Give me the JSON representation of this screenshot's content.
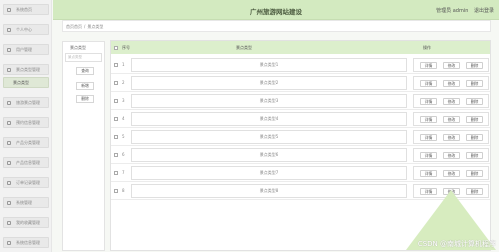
{
  "header": {
    "title": "广州旅游网站建设",
    "user": "管理员 admin",
    "logout": "退出登录"
  },
  "breadcrumb": {
    "home": "首页首页",
    "sep": "/",
    "current": "景点类型"
  },
  "sidebar": {
    "items": [
      {
        "label": "系统首页"
      },
      {
        "label": "个人中心"
      },
      {
        "label": "用户管理"
      },
      {
        "label": "景点类型管理"
      },
      {
        "label": "景点类型"
      },
      {
        "label": "旅游景点管理"
      },
      {
        "label": "预约信息管理"
      },
      {
        "label": "产品分类管理"
      },
      {
        "label": "产品信息管理"
      },
      {
        "label": "订单记录管理"
      },
      {
        "label": "系统管理"
      },
      {
        "label": "我的收藏管理"
      },
      {
        "label": "系统信息管理"
      }
    ]
  },
  "subpanel": {
    "title": "景点类型",
    "search_placeholder": "景点类型",
    "buttons": [
      "查询",
      "新增",
      "删除"
    ]
  },
  "table": {
    "headers": {
      "index": "序号",
      "name": "景点类型",
      "ops": "操作"
    },
    "op_labels": [
      "详情",
      "修改",
      "删除"
    ],
    "rows": [
      {
        "idx": "1",
        "name": "景点类型1"
      },
      {
        "idx": "2",
        "name": "景点类型2"
      },
      {
        "idx": "3",
        "name": "景点类型3"
      },
      {
        "idx": "4",
        "name": "景点类型4"
      },
      {
        "idx": "5",
        "name": "景点类型5"
      },
      {
        "idx": "6",
        "name": "景点类型6"
      },
      {
        "idx": "7",
        "name": "景点类型7"
      },
      {
        "idx": "8",
        "name": "景点类型8"
      }
    ]
  },
  "watermark": "CSDN @南城计算机程序"
}
